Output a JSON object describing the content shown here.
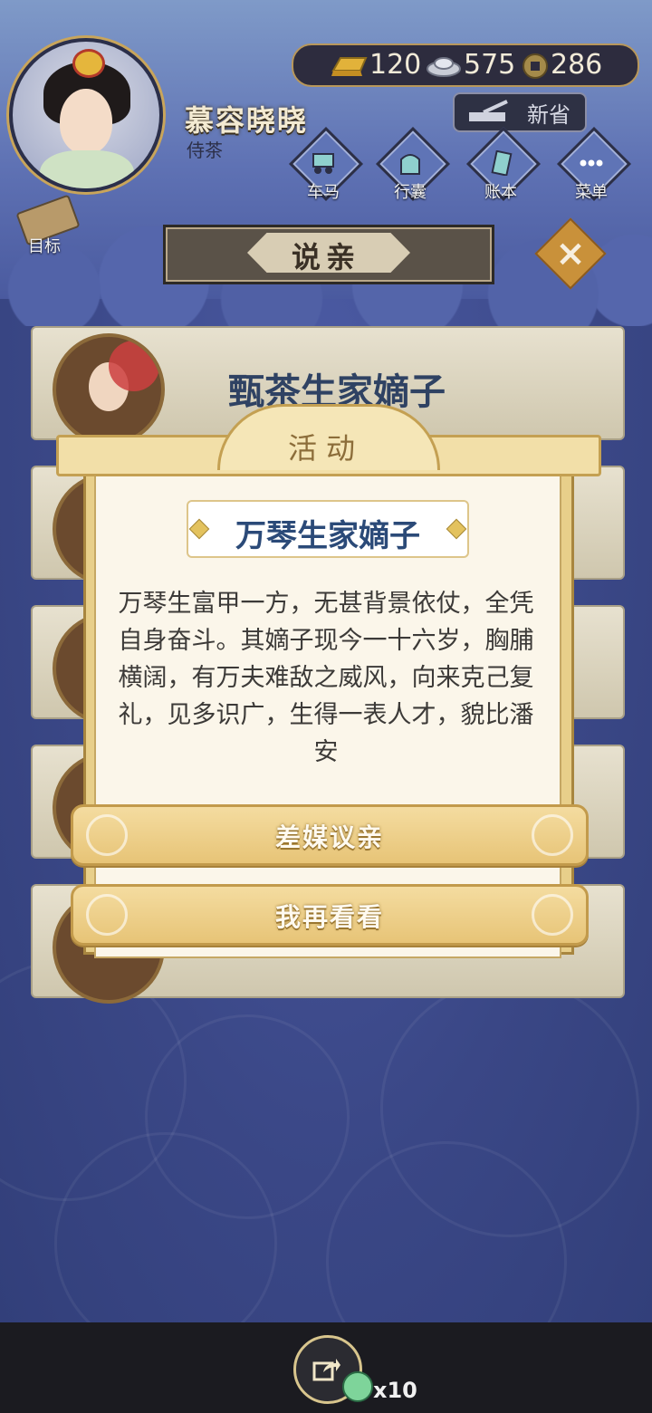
{
  "player": {
    "name": "慕容晓晓",
    "title": "侍茶"
  },
  "currency": {
    "gold": "120",
    "silver": "575",
    "coins": "286"
  },
  "ministry": {
    "label": "新省"
  },
  "menu": [
    {
      "label": "车马",
      "icon": "carriage-icon"
    },
    {
      "label": "行囊",
      "icon": "bag-icon"
    },
    {
      "label": "账本",
      "icon": "ledger-icon"
    },
    {
      "label": "菜单",
      "icon": "more-icon"
    }
  ],
  "goal": {
    "label": "目标"
  },
  "page_title": "说亲",
  "list": {
    "first_name": "甄茶生家嫡子"
  },
  "popup": {
    "header": "活动",
    "title": "万琴生家嫡子",
    "description": "万琴生富甲一方，无甚背景依仗，全凭自身奋斗。其嫡子现今一十六岁，胸脯横阔，有万夫难敌之威风，向来克己复礼，见多识广，生得一表人才，貌比潘安",
    "confirm_label": "差媒议亲",
    "cancel_label": "我再看看"
  },
  "bottom": {
    "token_count": "x10"
  },
  "colors": {
    "accent_gold": "#e7c477",
    "title_blue": "#2b4a78",
    "bg_blue": "#3d4a8a"
  }
}
